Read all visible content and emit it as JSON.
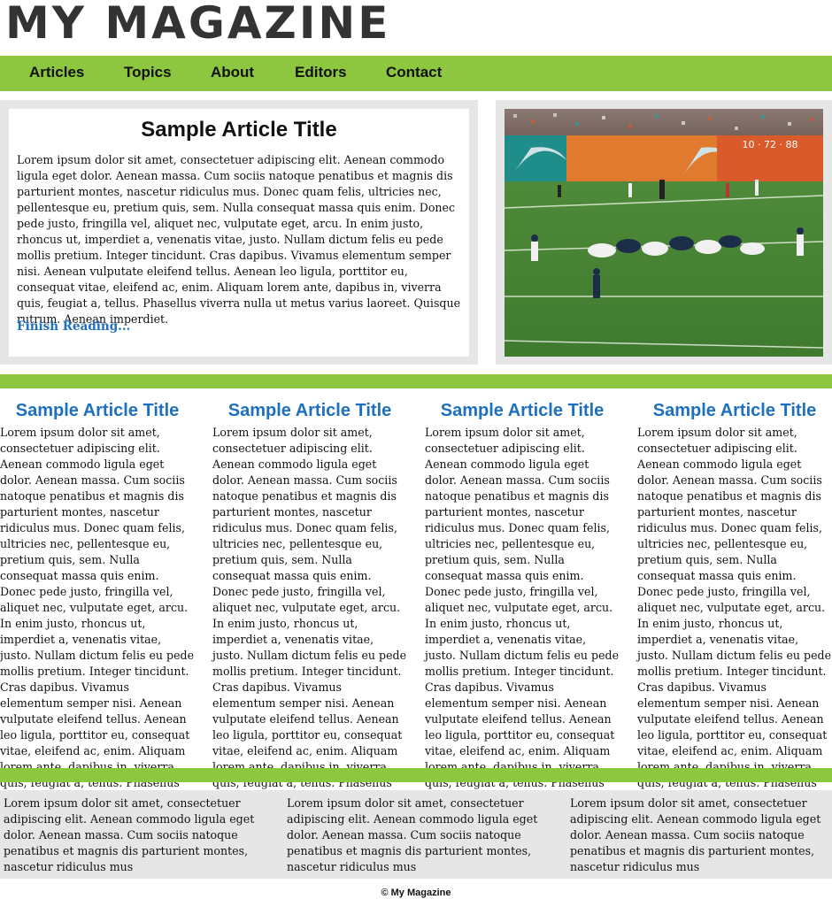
{
  "masthead": {
    "title": "MY MAGAZINE"
  },
  "nav": {
    "items": [
      "Articles",
      "Topics",
      "About",
      "Editors",
      "Contact"
    ]
  },
  "feature": {
    "title": "Sample Article Title",
    "body": "Lorem ipsum dolor sit amet, consectetuer adipiscing elit. Aenean commodo ligula eget dolor. Aenean massa. Cum sociis natoque penatibus et magnis dis parturient montes, nascetur ridiculus mus. Donec quam felis, ultricies nec, pellentesque eu, pretium quis, sem. Nulla consequat massa quis enim. Donec pede justo, fringilla vel, aliquet nec, vulputate eget, arcu. In enim justo, rhoncus ut, imperdiet a, venenatis vitae, justo. Nullam dictum felis eu pede mollis pretium. Integer tincidunt. Cras dapibus. Vivamus elementum semper nisi. Aenean vulputate eleifend tellus. Aenean leo ligula, porttitor eu, consequat vitae, eleifend ac, enim. Aliquam lorem ante, dapibus in, viverra quis, feugiat a, tellus. Phasellus viverra nulla ut metus varius laoreet. Quisque rutrum. Aenean imperdiet.",
    "more": "Finish Reading..."
  },
  "photo": {
    "icon": "football-game-photo"
  },
  "articles": [
    {
      "title": "Sample Article Title",
      "body": "Lorem ipsum dolor sit amet, consectetuer adipiscing elit. Aenean commodo ligula eget dolor. Aenean massa. Cum sociis natoque penatibus et magnis dis parturient montes, nascetur ridiculus mus. Donec quam felis, ultricies nec, pellentesque eu, pretium quis, sem. Nulla consequat massa quis enim. Donec pede justo, fringilla vel, aliquet nec, vulputate eget, arcu. In enim justo, rhoncus ut, imperdiet a, venenatis vitae, justo. Nullam dictum felis eu pede mollis pretium. Integer tincidunt. Cras dapibus. Vivamus elementum semper nisi. Aenean vulputate eleifend tellus. Aenean leo ligula, porttitor eu, consequat vitae, eleifend ac, enim. Aliquam lorem ante, dapibus in, viverra quis, feugiat a, tellus. Phasellus viverra nulla ut metus varius laoreet."
    },
    {
      "title": "Sample Article Title",
      "body": "Lorem ipsum dolor sit amet, consectetuer adipiscing elit. Aenean commodo ligula eget dolor. Aenean massa. Cum sociis natoque penatibus et magnis dis parturient montes, nascetur ridiculus mus. Donec quam felis, ultricies nec, pellentesque eu, pretium quis, sem. Nulla consequat massa quis enim. Donec pede justo, fringilla vel, aliquet nec, vulputate eget, arcu. In enim justo, rhoncus ut, imperdiet a, venenatis vitae, justo. Nullam dictum felis eu pede mollis pretium. Integer tincidunt. Cras dapibus. Vivamus elementum semper nisi. Aenean vulputate eleifend tellus. Aenean leo ligula, porttitor eu, consequat vitae, eleifend ac, enim. Aliquam lorem ante, dapibus in, viverra quis, feugiat a, tellus. Phasellus viverra nulla ut metus varius laoreet."
    },
    {
      "title": "Sample Article Title",
      "body": "Lorem ipsum dolor sit amet, consectetuer adipiscing elit. Aenean commodo ligula eget dolor. Aenean massa. Cum sociis natoque penatibus et magnis dis parturient montes, nascetur ridiculus mus. Donec quam felis, ultricies nec, pellentesque eu, pretium quis, sem. Nulla consequat massa quis enim. Donec pede justo, fringilla vel, aliquet nec, vulputate eget, arcu. In enim justo, rhoncus ut, imperdiet a, venenatis vitae, justo. Nullam dictum felis eu pede mollis pretium. Integer tincidunt. Cras dapibus. Vivamus elementum semper nisi. Aenean vulputate eleifend tellus. Aenean leo ligula, porttitor eu, consequat vitae, eleifend ac, enim. Aliquam lorem ante, dapibus in, viverra quis, feugiat a, tellus. Phasellus viverra nulla ut metus varius laoreet."
    },
    {
      "title": "Sample Article Title",
      "body": "Lorem ipsum dolor sit amet, consectetuer adipiscing elit. Aenean commodo ligula eget dolor. Aenean massa. Cum sociis natoque penatibus et magnis dis parturient montes, nascetur ridiculus mus. Donec quam felis, ultricies nec, pellentesque eu, pretium quis, sem. Nulla consequat massa quis enim. Donec pede justo, fringilla vel, aliquet nec, vulputate eget, arcu. In enim justo, rhoncus ut, imperdiet a, venenatis vitae, justo. Nullam dictum felis eu pede mollis pretium. Integer tincidunt. Cras dapibus. Vivamus elementum semper nisi. Aenean vulputate eleifend tellus. Aenean leo ligula, porttitor eu, consequat vitae, eleifend ac, enim. Aliquam lorem ante, dapibus in, viverra quis, feugiat a, tellus. Phasellus viverra nulla ut metus varius laoreet."
    }
  ],
  "footer_blocks": [
    "Lorem ipsum dolor sit amet, consectetuer adipiscing elit. Aenean commodo ligula eget dolor. Aenean massa. Cum sociis natoque penatibus et magnis dis parturient montes, nascetur ridiculus mus",
    "Lorem ipsum dolor sit amet, consectetuer adipiscing elit. Aenean commodo ligula eget dolor. Aenean massa. Cum sociis natoque penatibus et magnis dis parturient montes, nascetur ridiculus mus",
    "Lorem ipsum dolor sit amet, consectetuer adipiscing elit. Aenean commodo ligula eget dolor. Aenean massa. Cum sociis natoque penatibus et magnis dis parturient montes, nascetur ridiculus mus"
  ],
  "copyright": "© My Magazine",
  "colors": {
    "accent": "#8dc63f",
    "link": "#1f6fbf",
    "panel": "#e6e6e6"
  }
}
